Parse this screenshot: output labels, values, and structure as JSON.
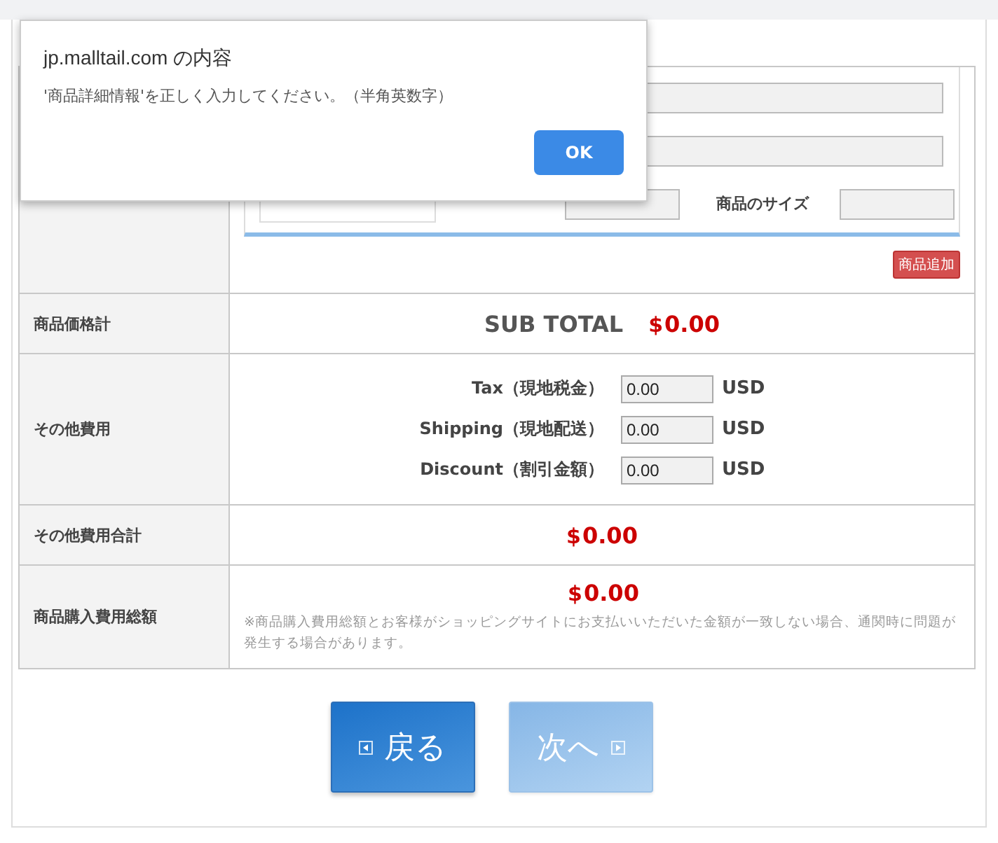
{
  "dialog": {
    "title": "jp.malltail.com の内容",
    "message": "'商品詳細情報'を正しく入力してください。（半角英数字）",
    "ok": "OK"
  },
  "product": {
    "size_label": "商品のサイズ",
    "add_button": "商品追加"
  },
  "subtotal": {
    "label": "商品価格計",
    "title": "SUB TOTAL",
    "currency": "$",
    "amount": "0.00"
  },
  "fees": {
    "label": "その他費用",
    "items": [
      {
        "name": "Tax（現地税金）",
        "value": "0.00",
        "unit": "USD"
      },
      {
        "name": "Shipping（現地配送）",
        "value": "0.00",
        "unit": "USD"
      },
      {
        "name": "Discount（割引金額）",
        "value": "0.00",
        "unit": "USD"
      }
    ]
  },
  "fees_total": {
    "label": "その他費用合計",
    "currency": "$",
    "amount": "0.00"
  },
  "grand_total": {
    "label": "商品購入費用総額",
    "currency": "$",
    "amount": "0.00",
    "note": "※商品購入費用総額とお客様がショッピングサイトにお支払いいただいた金額が一致しない場合、通関時に問題が発生する場合があります。"
  },
  "buttons": [
    {
      "label": "戻る",
      "kind": "back",
      "disabled": false
    },
    {
      "label": "次へ",
      "kind": "next",
      "disabled": true
    }
  ]
}
